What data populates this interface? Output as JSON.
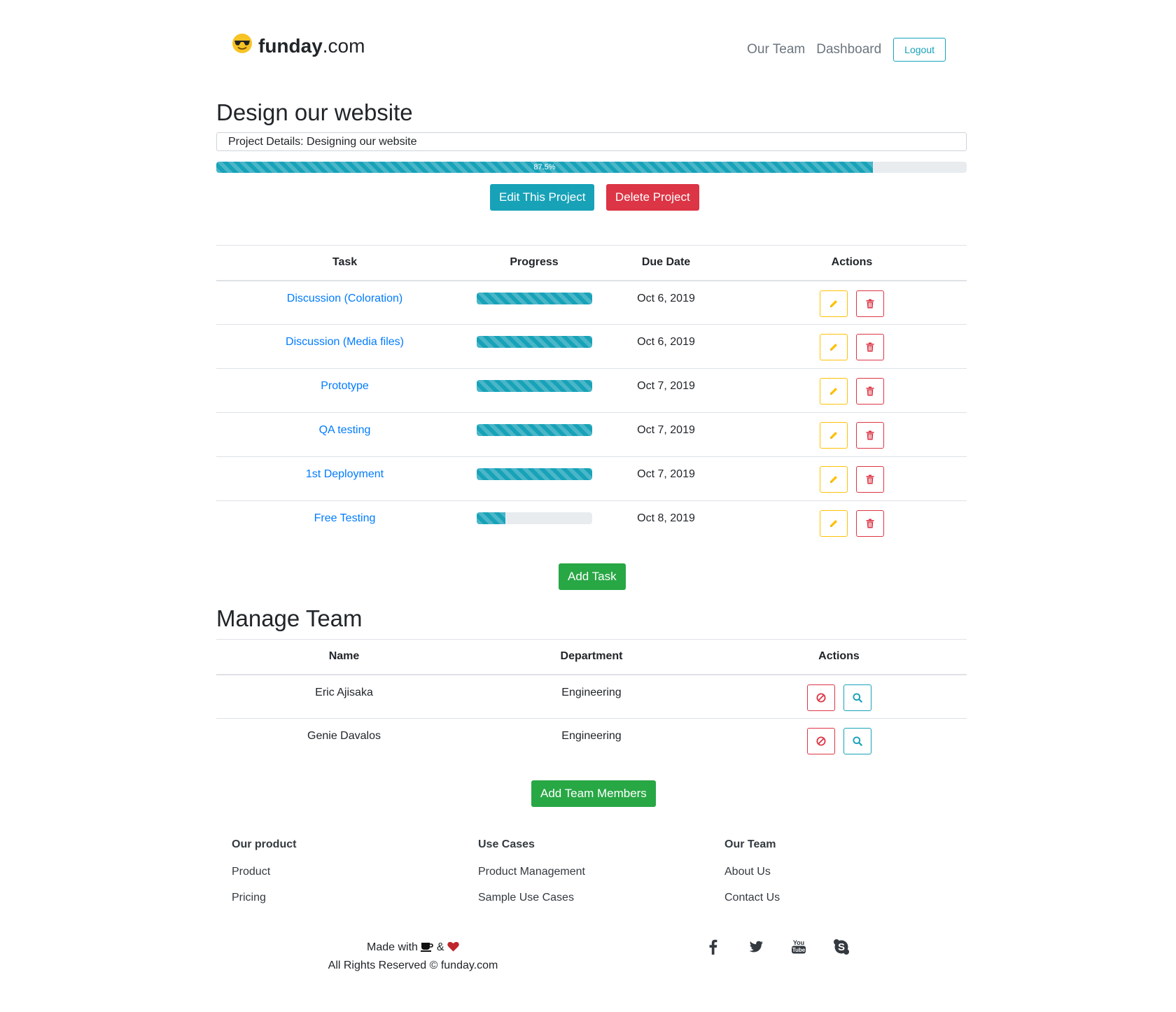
{
  "header": {
    "brand_bold": "funday",
    "brand_suffix": ".com",
    "nav": [
      "Our Team",
      "Dashboard"
    ],
    "logout_label": "Logout"
  },
  "project": {
    "title": "Design our website",
    "details": "Project Details: Designing our website",
    "progress_label": "87.5%",
    "progress_value": 0.875,
    "edit_label": "Edit This Project",
    "delete_label": "Delete Project"
  },
  "tasks": {
    "headers": [
      "Task",
      "Progress",
      "Due Date",
      "Actions"
    ],
    "rows": [
      {
        "name": "Discussion (Coloration)",
        "progress": 1.0,
        "due": "Oct 6, 2019"
      },
      {
        "name": "Discussion (Media files)",
        "progress": 1.0,
        "due": "Oct 6, 2019"
      },
      {
        "name": "Prototype",
        "progress": 1.0,
        "due": "Oct 7, 2019"
      },
      {
        "name": "QA testing",
        "progress": 1.0,
        "due": "Oct 7, 2019"
      },
      {
        "name": "1st Deployment",
        "progress": 1.0,
        "due": "Oct 7, 2019"
      },
      {
        "name": "Free Testing",
        "progress": 0.25,
        "due": "Oct 8, 2019"
      }
    ],
    "add_label": "Add Task"
  },
  "team": {
    "title": "Manage Team",
    "headers": [
      "Name",
      "Department",
      "Actions"
    ],
    "rows": [
      {
        "name": "Eric Ajisaka",
        "department": "Engineering"
      },
      {
        "name": "Genie Davalos",
        "department": "Engineering"
      }
    ],
    "add_label": "Add Team Members"
  },
  "footer": {
    "columns": [
      {
        "heading": "Our product",
        "links": [
          "Product",
          "Pricing"
        ]
      },
      {
        "heading": "Use Cases",
        "links": [
          "Product Management",
          "Sample Use Cases"
        ]
      },
      {
        "heading": "Our Team",
        "links": [
          "About Us",
          "Contact Us"
        ]
      }
    ],
    "made_with": "Made with",
    "made_and": "&",
    "rights": "All Rights Reserved © funday.com",
    "socials": [
      "facebook-icon",
      "twitter-icon",
      "youtube-icon",
      "skype-icon"
    ]
  },
  "colors": {
    "info": "#17a2b8",
    "danger": "#dc3545",
    "success": "#28a745",
    "warning": "#ffc107",
    "link": "#007bff"
  }
}
